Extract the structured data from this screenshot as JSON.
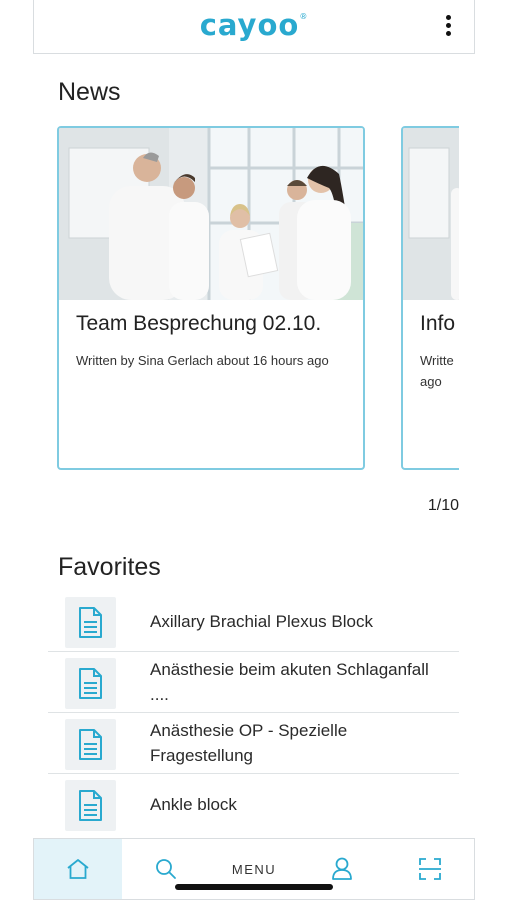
{
  "header": {
    "logo_text": "cayoo",
    "logo_mark": "®",
    "menu_icon": "kebab-vertical-icon"
  },
  "news": {
    "title": "News",
    "pager": "1/10",
    "cards": [
      {
        "title": "Team Besprechung 02.10.",
        "meta": "Written by Sina Gerlach about 16 hours ago"
      },
      {
        "title": "Info",
        "meta": "Writte ago"
      }
    ]
  },
  "favorites": {
    "title": "Favorites",
    "items": [
      {
        "label": "Axillary Brachial Plexus Block",
        "icon": "document-icon"
      },
      {
        "label": "Anästhesie beim akuten Schlaganfall ....",
        "icon": "document-icon"
      },
      {
        "label": "Anästhesie OP - Spezielle Fragestellung",
        "icon": "document-icon"
      },
      {
        "label": "Ankle block",
        "icon": "document-icon"
      }
    ]
  },
  "tabbar": {
    "active": "home",
    "menu_label": "MENU",
    "icons": [
      "home-icon",
      "search-icon",
      "user-icon",
      "scan-icon"
    ]
  },
  "colors": {
    "brand": "#29a9cf",
    "card_border": "#7fcbe1",
    "active_tab_bg": "#e3f3f9"
  }
}
